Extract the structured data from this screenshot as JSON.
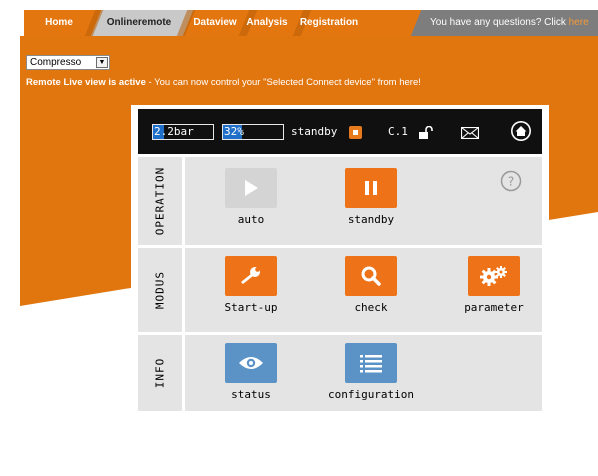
{
  "nav": {
    "items": [
      "Home",
      "Onlineremote",
      "Dataview",
      "Analysis",
      "Registration"
    ],
    "question_text": "You have any questions? Click ",
    "question_link": "here",
    "active_index": 1
  },
  "device_select": {
    "selected": "Compresso"
  },
  "live_message": {
    "strong": "Remote Live view is active",
    "rest": " - You can now control your \"Selected Connect device\" from here!"
  },
  "status_bar": {
    "pressure": "2.2bar",
    "pressure_fraction": 0.18,
    "percent": "32%",
    "percent_fraction": 0.32,
    "state": "standby",
    "code": "C.1",
    "icons": [
      "stop-icon",
      "unlock-icon",
      "mail-icon",
      "home-icon"
    ]
  },
  "sections": {
    "operation": {
      "label": "OPERATION",
      "buttons": [
        {
          "label": "auto",
          "icon": "play-icon",
          "style": "disabled"
        },
        {
          "label": "standby",
          "icon": "pause-icon",
          "style": "active"
        }
      ],
      "help_icon": "help-icon"
    },
    "modus": {
      "label": "MODUS",
      "buttons": [
        {
          "label": "Start-up",
          "icon": "wrench-icon"
        },
        {
          "label": "check",
          "icon": "magnifier-icon"
        },
        {
          "label": "parameter",
          "icon": "gears-icon"
        }
      ]
    },
    "info": {
      "label": "INFO",
      "buttons": [
        {
          "label": "status",
          "icon": "eye-icon"
        },
        {
          "label": "configuration",
          "icon": "list-icon"
        }
      ]
    }
  },
  "colors": {
    "brand_orange": "#e1760f",
    "button_orange": "#ee7218",
    "button_blue": "#5b93c6",
    "nav_gray": "#7d7d7d",
    "panel_gray": "#e4e4e4"
  }
}
